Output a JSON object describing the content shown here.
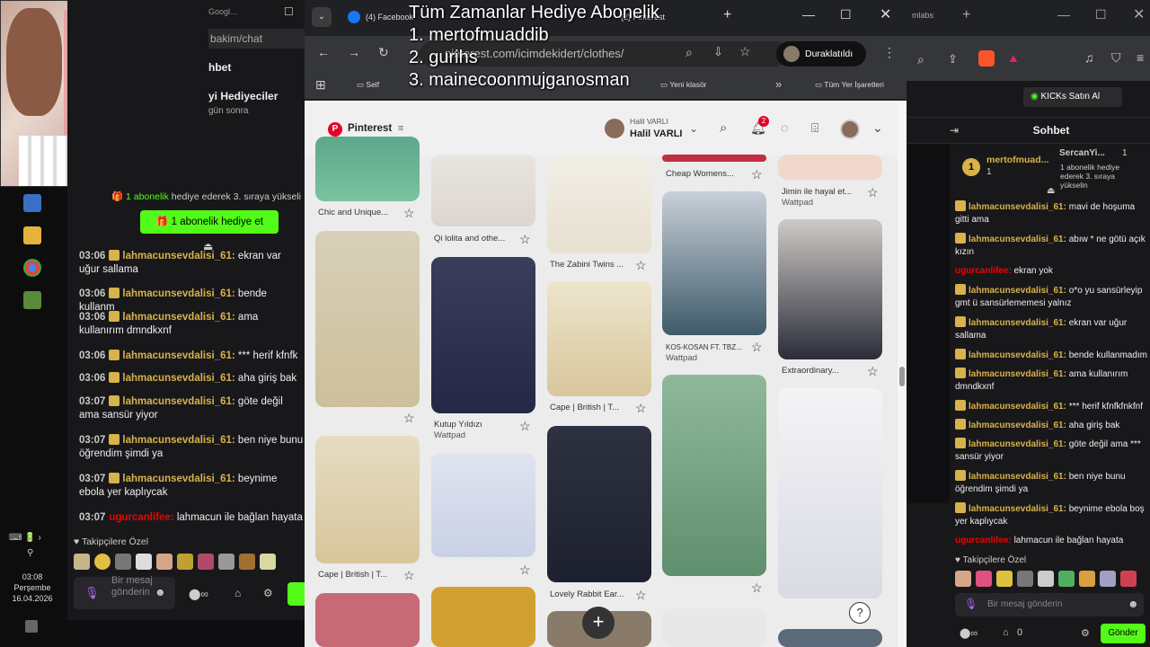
{
  "overlay": {
    "title": "Tüm Zamanlar Hediye  Abonelik",
    "line1": "1. mertofmuaddib",
    "line2": "2. gurihs",
    "line3": "3. mainecoonmujganosman"
  },
  "left_chat": {
    "address_fragment": "bakim/chat",
    "header": "hbet",
    "gift_title": "yi Hediyeciler",
    "gift_sub": "gün sonra",
    "gift_info_count": "1 abonelik",
    "gift_info_rest": "hediye ederek 3. sıraya yükseli",
    "gift_button": "1 abonelik hediye et",
    "messages": [
      {
        "time": "03:06",
        "user": "lahmacunsevdalisi_61:",
        "text": "ekran var uğur sallama",
        "color": "g"
      },
      {
        "time": "03:06",
        "user": "lahmacunsevdalisi_61:",
        "text": "bende kullanm",
        "color": "g"
      },
      {
        "time": "03:06",
        "user": "lahmacunsevdalisi_61:",
        "text": "ama kullanırım dmndkxnf",
        "color": "g"
      },
      {
        "time": "03:06",
        "user": "lahmacunsevdalisi_61:",
        "text": "*** herif kfnfk",
        "color": "g"
      },
      {
        "time": "03:06",
        "user": "lahmacunsevdalisi_61:",
        "text": "aha giriş bak",
        "color": "g"
      },
      {
        "time": "03:07",
        "user": "lahmacunsevdalisi_61:",
        "text": "göte değil ama sansür yiyor",
        "color": "g"
      },
      {
        "time": "03:07",
        "user": "lahmacunsevdalisi_61:",
        "text": "ben niye bunu öğrendim şimdi ya",
        "color": "g"
      },
      {
        "time": "03:07",
        "user": "lahmacunsevdalisi_61:",
        "text": "beynime ebola yer kaplıycak",
        "color": "g"
      },
      {
        "time": "03:07",
        "user": "ugurcanlifee:",
        "text": "lahmacun ile bağlan hayata",
        "color": "r"
      }
    ],
    "followers_label": "Takipçilere Özel",
    "input_placeholder": "Bir mesaj gönderin",
    "clock_time": "03:08",
    "clock_day": "Perşembe",
    "clock_date": "16.04.2026"
  },
  "chrome": {
    "tabs": [
      {
        "label": "(4) Facebook"
      },
      {
        "label": "(2) Pinterest"
      }
    ],
    "url": "pinterest.com/icimdekidert/clothes/",
    "paused_label": "Duraklatıldı",
    "bookmarks": [
      "Self",
      "Yeni klasör",
      "Tüm Yer İşaretleri"
    ]
  },
  "pinterest": {
    "logo_text": "Pinterest",
    "profile_small": "Halil VARLI",
    "profile_name": "Halil VARLI",
    "notif_count": "2",
    "captions": {
      "c1a": "Chic and Unique...",
      "c1b": "Cape | British | T...",
      "c2a": "Qi lolita and othe...",
      "c2b": "Kutup Yıldızı",
      "c2b_sub": "Wattpad",
      "c3a": "The Zabini Twins ...",
      "c3b": "Cape | British | T...",
      "c3c": "Lovely Rabbit Ear...",
      "c4a": "Cheap Womens...",
      "c4b": "KOS-KOSAN FT. TBZ...",
      "c4b_sub": "Wattpad",
      "c5a": "Jimin ile hayal et...",
      "c5a_sub": "Wattpad",
      "c5b": "Extraordinary..."
    },
    "help": "?",
    "add": "+"
  },
  "right_chat": {
    "header": "Sohbet",
    "kick_button": "KICKs Satın Al",
    "top_gifter": "mertofmuad...",
    "top_gifter_count": "1",
    "second_gifter": "SercanYi...",
    "second_count": "1",
    "gift_note": "1 abonelik hediye ederek 3. sıraya yükselin",
    "messages": [
      {
        "user": "lahmacunsevdalisi_61:",
        "text": "mavi de hoşuma gitti ama",
        "color": "g"
      },
      {
        "user": "lahmacunsevdalisi_61:",
        "text": "abıw * ne götü açık kızın",
        "color": "g"
      },
      {
        "user": "ugurcanlifee:",
        "text": "ekran yok",
        "color": "r"
      },
      {
        "user": "lahmacunsevdalisi_61:",
        "text": "o*o yu sansürleyip gmt ü sansürlememesi yalnız",
        "color": "g"
      },
      {
        "user": "lahmacunsevdalisi_61:",
        "text": "ekran var uğur sallama",
        "color": "g"
      },
      {
        "user": "lahmacunsevdalisi_61:",
        "text": "bende kullanmadım",
        "color": "g"
      },
      {
        "user": "lahmacunsevdalisi_61:",
        "text": "ama kullanırım dmndkxnf",
        "color": "g"
      },
      {
        "user": "lahmacunsevdalisi_61:",
        "text": "*** herif kfnfkfnkfnf",
        "color": "g"
      },
      {
        "user": "lahmacunsevdalisi_61:",
        "text": "aha giriş bak",
        "color": "g"
      },
      {
        "user": "lahmacunsevdalisi_61:",
        "text": "göte değil ama *** sansür yiyor",
        "color": "g"
      },
      {
        "user": "lahmacunsevdalisi_61:",
        "text": "ben niye bunu öğrendim şimdi ya",
        "color": "g"
      },
      {
        "user": "lahmacunsevdalisi_61:",
        "text": "beynime ebola boş yer kaplıycak",
        "color": "g"
      },
      {
        "user": "ugurcanlifee:",
        "text": "lahmacun ile bağlan hayata",
        "color": "r"
      }
    ],
    "followers_label": "Takipçilere Özel",
    "input_placeholder": "Bir mesaj gönderin",
    "points": "0",
    "send_label": "Gönder"
  }
}
